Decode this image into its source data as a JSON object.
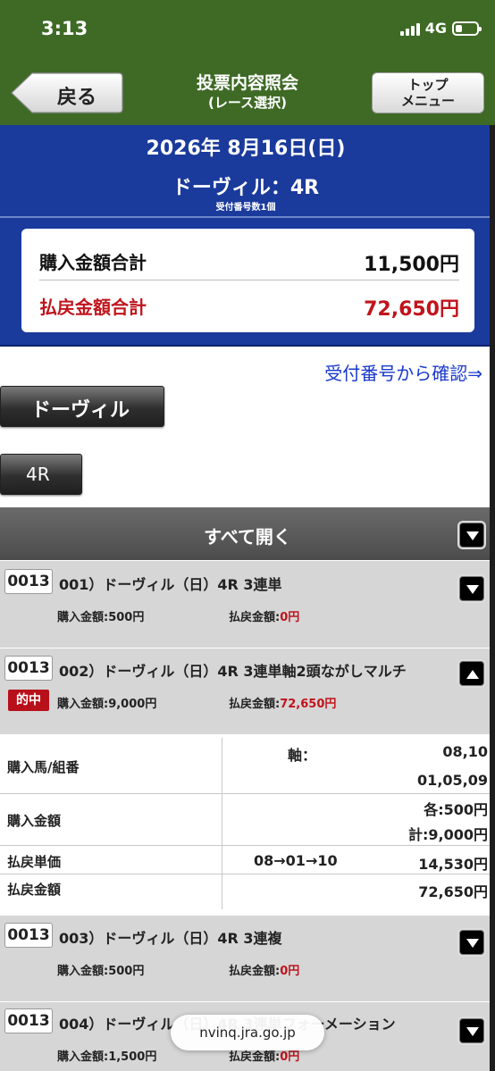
{
  "status_bar": {
    "time": "3:13",
    "network": "4G"
  },
  "header": {
    "back_label": "戻る",
    "title": "投票内容照会",
    "subtitle": "(レース選択)",
    "top_menu_line1": "トップ",
    "top_menu_line2": "メニュー"
  },
  "race_info": {
    "date": "2026年  8月16日(日)",
    "course": "ドーヴィル：4R",
    "receipt_count": "受付番号数1個"
  },
  "summary": {
    "purchase_label": "購入金額合計",
    "purchase_value": "11,500円",
    "payout_label": "払戻金額合計",
    "payout_value": "72,650円"
  },
  "confirm_link": "受付番号から確認⇒",
  "venue_button": "ドーヴィル",
  "race_button": "4R",
  "open_all": "すべて開く",
  "tickets": [
    {
      "receipt": "0013",
      "title": "001）ドーヴィル（日）4R  3連単",
      "purchase_label": "購入金額:",
      "purchase": "500円",
      "payout_label": "払戻金額:",
      "payout": "0円",
      "hit": ""
    },
    {
      "receipt": "0013",
      "title": "002）ドーヴィル（日）4R  3連単軸2頭ながしマルチ",
      "purchase_label": "購入金額:",
      "purchase": "9,000円",
      "payout_label": "払戻金額:",
      "payout": "72,650円",
      "hit": "的中"
    },
    {
      "receipt": "0013",
      "title": "003）ドーヴィル（日）4R  3連複",
      "purchase_label": "購入金額:",
      "purchase": "500円",
      "payout_label": "払戻金額:",
      "payout": "0円",
      "hit": ""
    },
    {
      "receipt": "0013",
      "title": "004）ドーヴィル（日）4R  3連単フォーメーション",
      "purchase_label": "購入金額:",
      "purchase": "1,500円",
      "payout_label": "払戻金額:",
      "payout": "0円",
      "hit": ""
    }
  ],
  "detail": {
    "horses_label": "購入馬/組番",
    "axis_label": "軸：",
    "axis_value": "08,10",
    "partners": "01,05,09",
    "amount_label": "購入金額",
    "each": "各:500円",
    "total": "計:9,000円",
    "unit_label": "払戻単価",
    "combination": "08→01→10",
    "unit_value": "14,530円",
    "payout_label": "払戻金額",
    "payout_value": "72,650円"
  },
  "url": "nvinq.jra.go.jp",
  "colors": {
    "header_green": "#3f6a26",
    "summary_blue": "#1a3a9c",
    "accent_red": "#c0141c",
    "link_blue": "#1a3acc"
  }
}
